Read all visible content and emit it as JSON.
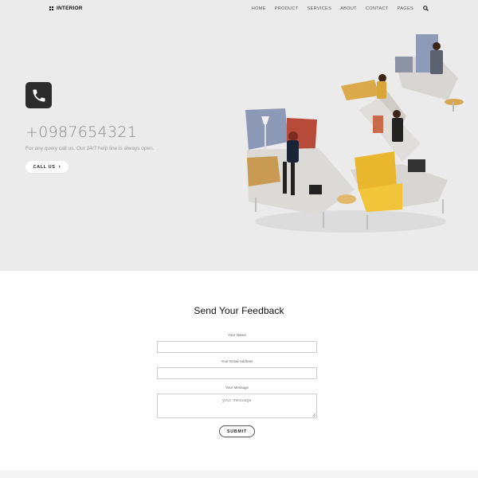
{
  "brand": {
    "name": "INTERIOR"
  },
  "nav": {
    "items": [
      "HOME",
      "PRODUCT",
      "SERVICES",
      "ABOUT",
      "CONTACT",
      "PAGES"
    ],
    "search_icon": "search-icon"
  },
  "hero": {
    "phone_icon": "phone-icon",
    "phone_number": "+0987654321",
    "subtitle": "For any query call us. Our 24/7 help line is always open.",
    "call_button": "CALL US",
    "image": "modular-lounge-seating-with-people"
  },
  "feedback": {
    "title": "Send Your Feedback",
    "name_label": "Your Name",
    "email_label": "Your Email Address",
    "message_label": "Your Message",
    "message_placeholder": "your message",
    "submit_label": "SUBMIT"
  },
  "colors": {
    "hero_bg": "#ebebeb",
    "phone_tile": "#2c2c2c",
    "accent_yellow": "#e8b22c",
    "sofa_grey": "#d9d7d3",
    "panel_blue": "#8a9ab8"
  }
}
